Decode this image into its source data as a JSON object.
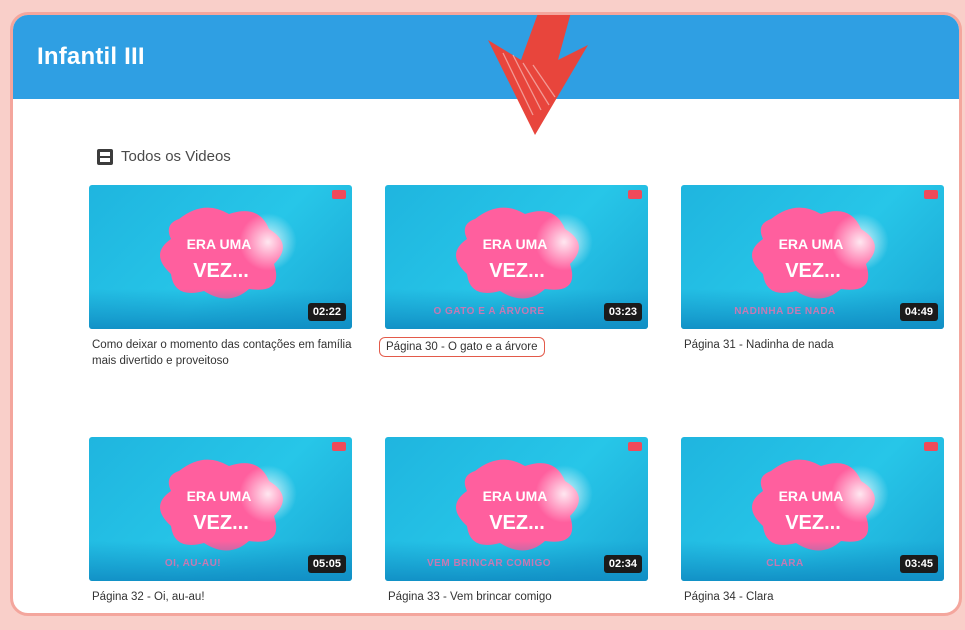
{
  "header": {
    "title": "Infantil III"
  },
  "section": {
    "label": "Todos os Videos",
    "icon": "video-icon"
  },
  "thumbnail_logo": {
    "line1": "ERA UMA",
    "line2": "VEZ..."
  },
  "videos": [
    {
      "title": "Como deixar o momento das contações em família mais divertido e proveitoso",
      "duration": "02:22",
      "subtitle": "",
      "highlighted": false
    },
    {
      "title": "Página 30 - O gato e a árvore",
      "duration": "03:23",
      "subtitle": "O GATO E A ÁRVORE",
      "highlighted": true
    },
    {
      "title": "Página 31 - Nadinha de nada",
      "duration": "04:49",
      "subtitle": "NADINHA DE NADA",
      "highlighted": false
    },
    {
      "title": "Página 32 - Oi, au-au!",
      "duration": "05:05",
      "subtitle": "OI, AU-AU!",
      "highlighted": false
    },
    {
      "title": "Página 33 - Vem brincar comigo",
      "duration": "02:34",
      "subtitle": "VEM BRINCAR COMIGO",
      "highlighted": false
    },
    {
      "title": "Página 34 - Clara",
      "duration": "03:45",
      "subtitle": "CLARA",
      "highlighted": false
    }
  ],
  "colors": {
    "header": "#2f9fe3",
    "frame_border": "#f4a69d",
    "background": "#f9cfc9",
    "arrow": "#e8453c",
    "highlight": "#e35a4a"
  }
}
